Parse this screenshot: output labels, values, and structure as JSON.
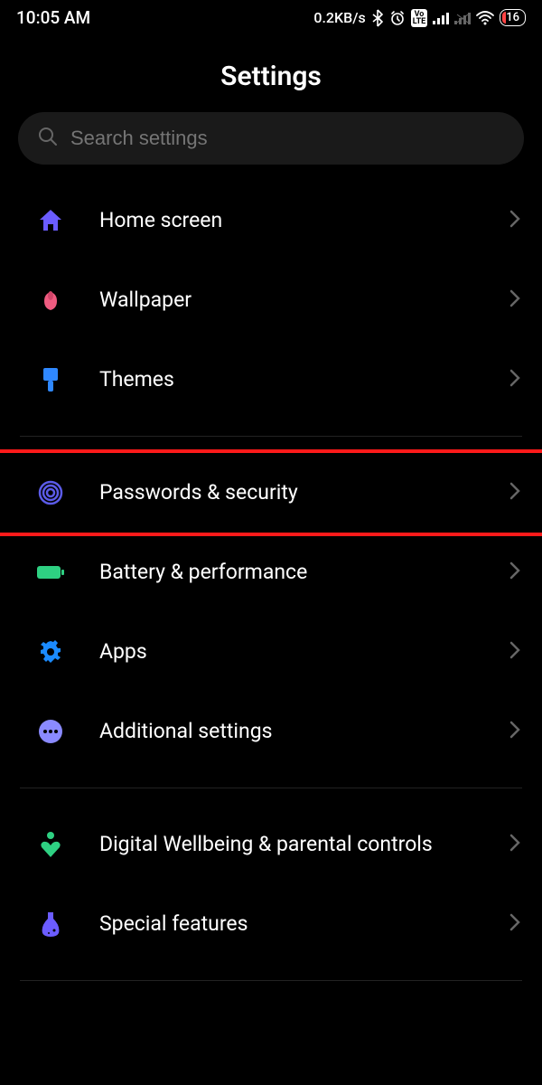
{
  "status": {
    "time": "10:05 AM",
    "net_speed": "0.2KB/s",
    "battery": "16",
    "volte": "Vo\nLTE"
  },
  "title": "Settings",
  "search": {
    "placeholder": "Search settings"
  },
  "groups": [
    {
      "items": [
        {
          "id": "home-screen",
          "label": "Home screen",
          "icon": "home",
          "color": "#6b5cff"
        },
        {
          "id": "wallpaper",
          "label": "Wallpaper",
          "icon": "flower",
          "color": "#ef5b80"
        },
        {
          "id": "themes",
          "label": "Themes",
          "icon": "brush",
          "color": "#2f88ff"
        }
      ]
    },
    {
      "items": [
        {
          "id": "passwords-security",
          "label": "Passwords & security",
          "icon": "fingerprint",
          "color": "#5b5be8",
          "highlight": true
        },
        {
          "id": "battery-performance",
          "label": "Battery & performance",
          "icon": "battery",
          "color": "#2ed082"
        },
        {
          "id": "apps",
          "label": "Apps",
          "icon": "gear",
          "color": "#1b8bff"
        },
        {
          "id": "additional-settings",
          "label": "Additional settings",
          "icon": "dots",
          "color": "#8a8aff"
        }
      ]
    },
    {
      "items": [
        {
          "id": "wellbeing",
          "label": "Digital Wellbeing & parental controls",
          "icon": "heart",
          "color": "#2ed082"
        },
        {
          "id": "special-features",
          "label": "Special features",
          "icon": "flask",
          "color": "#6b5cff"
        }
      ]
    }
  ]
}
